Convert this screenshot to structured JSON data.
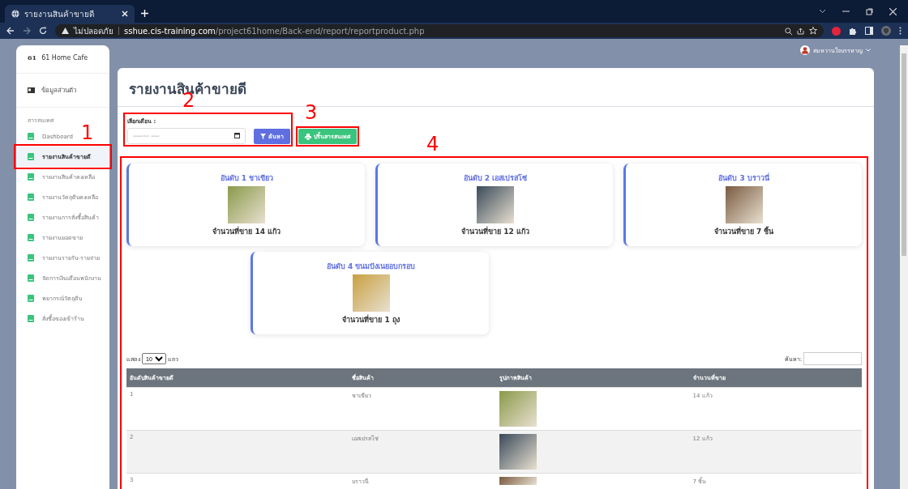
{
  "browser": {
    "tab_title": "รายงานสินค้าขายดี",
    "security": "ไม่ปลอดภัย",
    "url_host": "sshue.cis-training.com",
    "url_path": "/project61home/Back-end/report/reportproduct.php"
  },
  "sidebar": {
    "brand_mark": "61",
    "brand": "61 Home Cafe",
    "profile": "ข้อมูลส่วนตัว",
    "section": "สารสนเทศ",
    "items": [
      {
        "label": "Dashboard",
        "selected": false
      },
      {
        "label": "รายงานสินค้าขายดี",
        "selected": true
      },
      {
        "label": "รายงานสินค้าคงเหลือ",
        "selected": false
      },
      {
        "label": "รายงานวัตถุดิบคงเหลือ",
        "selected": false
      },
      {
        "label": "รายงานการสั่งซื้อสินค้า",
        "selected": false
      },
      {
        "label": "รายงานยอดขาย",
        "selected": false
      },
      {
        "label": "รายงานรายรับ-รายจ่าย",
        "selected": false
      },
      {
        "label": "จัดการเงินเดือนพนักงาน",
        "selected": false
      },
      {
        "label": "พยากรณ์วัตถุดิบ",
        "selected": false
      },
      {
        "label": "สั่งซื้อของเข้าร้าน",
        "selected": false
      }
    ]
  },
  "user": {
    "name": "สมหวานใจบรรหาญ"
  },
  "page": {
    "title": "รายงานสินค้าขายดี",
    "month_label": "เลือกเดือน :",
    "month_placeholder": "-------- ----",
    "search_button": "ค้นหา",
    "print_button": "ปริ้นสารสนเทศ"
  },
  "top_products": [
    {
      "title": "อันดับ 1 ชาเขียว",
      "sold": "จำนวนที่ขาย 14 แก้ว"
    },
    {
      "title": "อันดับ 2 เอสเปรสโซ่",
      "sold": "จำนวนที่ขาย 12 แก้ว"
    },
    {
      "title": "อันดับ 3 บราวนี่",
      "sold": "จำนวนที่ขาย 7 ชิ้น"
    },
    {
      "title": "อันดับ 4 ขนมปังเนยอบกรอบ",
      "sold": "จำนวนที่ขาย 1 ถุง"
    }
  ],
  "table": {
    "show_label": "แสดง",
    "page_size": "10",
    "rows_label": "แถว",
    "search_label": "ค้นหา:",
    "columns": [
      "อันดับสินค้าขายดี",
      "ชื่อสินค้า",
      "รูปภาพสินค้า",
      "จำนวนที่ขาย"
    ],
    "rows": [
      {
        "rank": "1",
        "name": "ชาเขียว",
        "sold": "14 แก้ว"
      },
      {
        "rank": "2",
        "name": "เอสเปรสโซ่",
        "sold": "12 แก้ว"
      },
      {
        "rank": "3",
        "name": "บราวนี่",
        "sold": "7 ชิ้น"
      }
    ]
  },
  "annotations": [
    {
      "label": "1"
    },
    {
      "label": "2"
    },
    {
      "label": "3"
    },
    {
      "label": "4"
    }
  ]
}
